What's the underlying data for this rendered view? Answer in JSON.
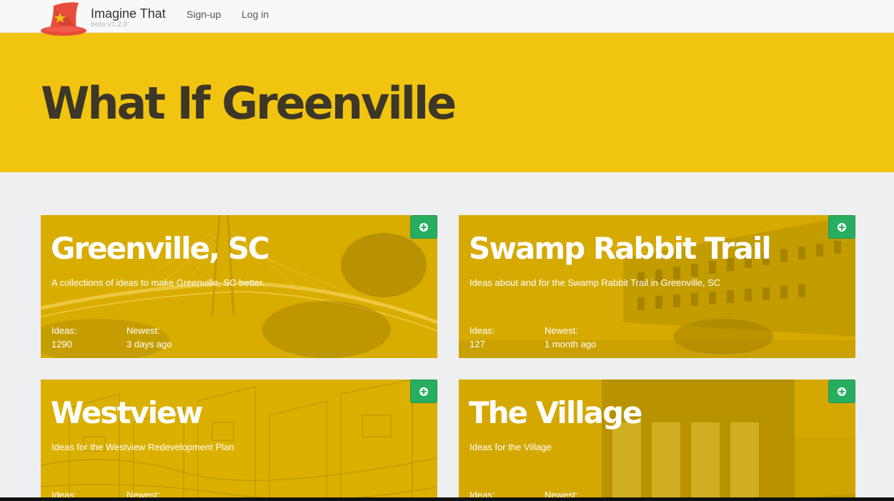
{
  "navbar": {
    "brand": "Imagine That",
    "version": "beta v1.2.0",
    "links": {
      "signup": "Sign-up",
      "login": "Log in"
    }
  },
  "hero": {
    "title": "What If Greenville"
  },
  "cards": [
    {
      "title": "Greenville, SC",
      "description": "A collections of ideas to make Greenville, SC better.",
      "ideas_label": "Ideas:",
      "ideas": "1290",
      "newest_label": "Newest:",
      "newest": "3 days ago"
    },
    {
      "title": "Swamp Rabbit Trail",
      "description": "Ideas about and for the Swamp Rabbit Trail in Greenville, SC",
      "ideas_label": "Ideas:",
      "ideas": "127",
      "newest_label": "Newest:",
      "newest": "1 month ago"
    },
    {
      "title": "Westview",
      "description": "Ideas for the Westview Redevelopment Plan",
      "ideas_label": "Ideas:",
      "ideas": "",
      "newest_label": "Newest:",
      "newest": ""
    },
    {
      "title": "The Village",
      "description": "Ideas for the Village",
      "ideas_label": "Ideas:",
      "ideas": "",
      "newest_label": "Newest:",
      "newest": ""
    }
  ],
  "icons": {
    "logo": "wizard-hat-icon",
    "add": "plus-circle-icon"
  },
  "colors": {
    "hero": "#f1c40f",
    "card": "#d4ab0a",
    "add_button": "#27ae60",
    "title_dark": "#3d3728"
  }
}
